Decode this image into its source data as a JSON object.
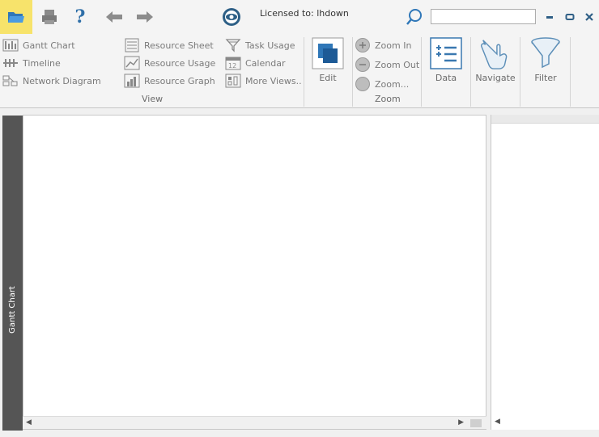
{
  "titlebar": {
    "license_text": "Licensed to: lhdown",
    "search_placeholder": "",
    "icons": [
      "folder-open-icon",
      "print-icon",
      "help-icon",
      "back-arrow-icon",
      "forward-arrow-icon",
      "eye-icon",
      "search-icon",
      "minimize-icon",
      "restore-icon",
      "close-icon"
    ],
    "accent_color": "#f7e36b"
  },
  "ribbon": {
    "view": {
      "col1": [
        {
          "label": "Gantt Chart",
          "icon": "gantt-chart-icon"
        },
        {
          "label": "Timeline",
          "icon": "timeline-icon"
        },
        {
          "label": "Network Diagram",
          "icon": "network-diagram-icon"
        }
      ],
      "col2": [
        {
          "label": "Resource Sheet",
          "icon": "resource-sheet-icon"
        },
        {
          "label": "Resource Usage",
          "icon": "resource-usage-icon"
        },
        {
          "label": "Resource Graph",
          "icon": "resource-graph-icon"
        }
      ],
      "col3": [
        {
          "label": "Task Usage",
          "icon": "task-usage-icon"
        },
        {
          "label": "Calendar",
          "icon": "calendar-icon"
        },
        {
          "label": "More Views..",
          "icon": "more-views-icon"
        }
      ],
      "group_label": "View"
    },
    "edit": {
      "label": "Edit",
      "icon": "edit-icon"
    },
    "zoom": {
      "items": [
        {
          "label": "Zoom In",
          "icon": "zoom-in-icon"
        },
        {
          "label": "Zoom Out",
          "icon": "zoom-out-icon"
        },
        {
          "label": "Zoom...",
          "icon": "zoom-icon"
        }
      ],
      "group_label": "Zoom"
    },
    "data": {
      "label": "Data",
      "icon": "data-icon"
    },
    "navigate": {
      "label": "Navigate",
      "icon": "hand-pointer-icon"
    },
    "filter": {
      "label": "Filter",
      "icon": "funnel-icon"
    }
  },
  "workspace": {
    "side_tab_label": "Gantt Chart",
    "side_tab_color": "#555555"
  }
}
